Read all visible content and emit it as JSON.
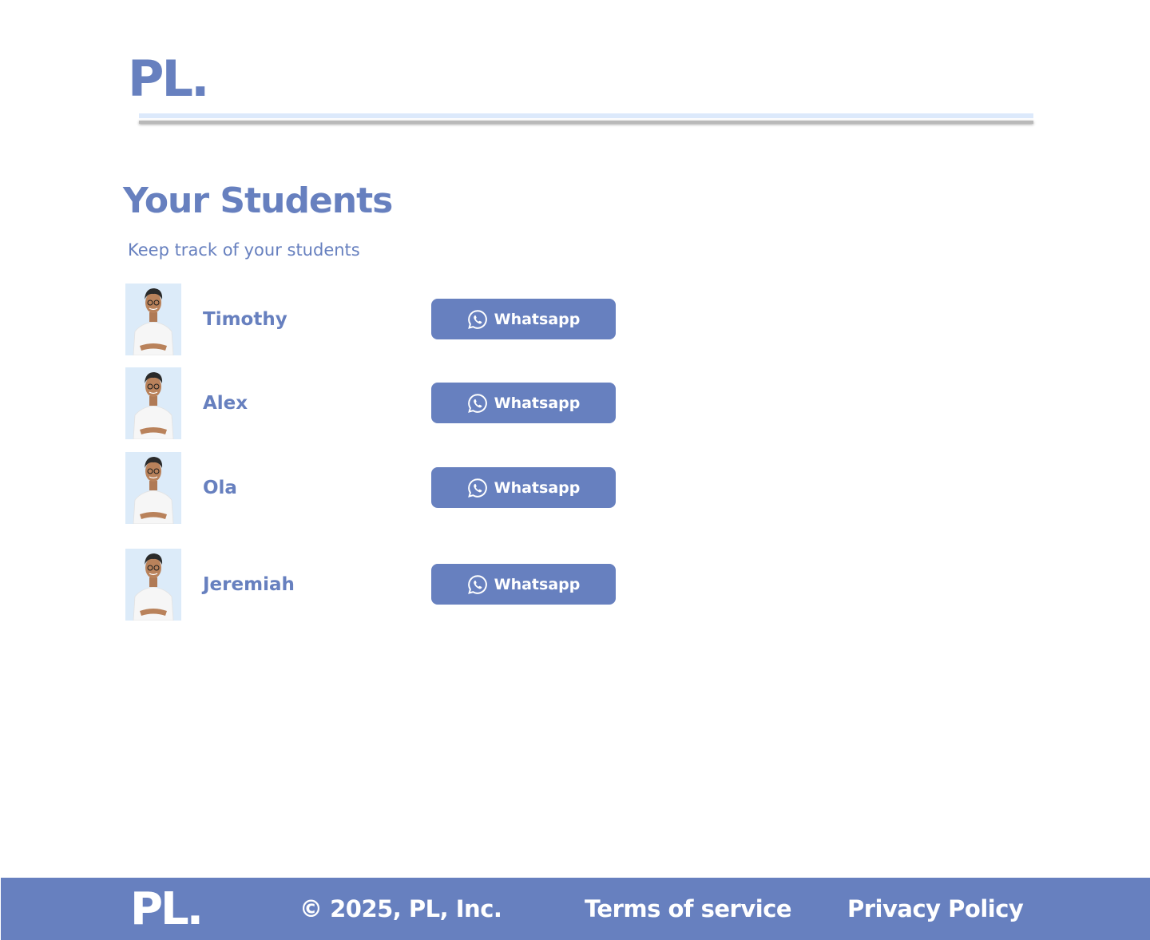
{
  "header": {
    "logo_text": "PL."
  },
  "main": {
    "title": "Your Students",
    "subtitle": "Keep track of your students"
  },
  "students": [
    {
      "name": "Timothy",
      "action_label": "Whatsapp"
    },
    {
      "name": "Alex",
      "action_label": "Whatsapp"
    },
    {
      "name": "Ola",
      "action_label": "Whatsapp"
    },
    {
      "name": "Jeremiah",
      "action_label": "Whatsapp"
    }
  ],
  "footer": {
    "logo_text": "PL.",
    "copyright": "© 2025, PL, Inc.",
    "terms_label": "Terms of service",
    "privacy_label": "Privacy Policy"
  },
  "icons": {
    "whatsapp": "whatsapp-icon",
    "avatar": "student-photo"
  },
  "colors": {
    "brand": "#6780bf",
    "button_text": "#ffffff",
    "divider_light": "#dce9fb",
    "divider_dark": "#b9b9b9",
    "background": "#ffffff"
  }
}
